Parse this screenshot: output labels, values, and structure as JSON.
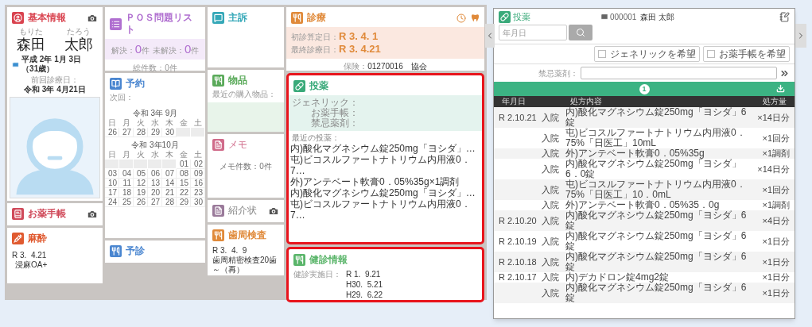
{
  "dashboard": {
    "basic_info": {
      "title": "基本情報",
      "furigana_last": "もりた",
      "furigana_first": "たろう",
      "last_name": "森田",
      "first_name": "太郎",
      "birth": "平成 2年 1月 3日（31歳）",
      "last_visit_label": "前回診療日：",
      "last_visit": "令和 3年 4月21日"
    },
    "okusuri_techo": {
      "title": "お薬手帳"
    },
    "anesthesia": {
      "title": "麻酔",
      "date": "R 3.  4.21",
      "detail": "浸麻OA+"
    },
    "pos": {
      "title": "ＰＯＳ問題リスト",
      "counts": [
        {
          "label": "解決：",
          "value": "0",
          "unit": "件"
        },
        {
          "label": "未解決：",
          "value": "0",
          "unit": "件"
        }
      ],
      "total": "総件数：0件"
    },
    "reservation": {
      "title": "予約",
      "next_label": "次回：",
      "calendars": [
        {
          "title": "令和 3年 9月",
          "weekdays": [
            "日",
            "月",
            "火",
            "水",
            "木",
            "金",
            "土"
          ],
          "days": [
            {
              "day": "26"
            },
            {
              "day": "27"
            },
            {
              "day": "28"
            },
            {
              "day": "29"
            },
            {
              "day": "30"
            },
            {
              "blank": true
            },
            {
              "blank": true
            }
          ]
        },
        {
          "title": "令和 3年10月",
          "weekdays": [
            "日",
            "月",
            "火",
            "水",
            "木",
            "金",
            "土"
          ],
          "days": [
            {
              "blank": true
            },
            {
              "blank": true
            },
            {
              "blank": true
            },
            {
              "blank": true
            },
            {
              "blank": true
            },
            {
              "day": "01"
            },
            {
              "day": "02"
            },
            {
              "day": "03"
            },
            {
              "day": "04"
            },
            {
              "day": "05"
            },
            {
              "day": "06"
            },
            {
              "day": "07"
            },
            {
              "day": "08"
            },
            {
              "day": "09"
            },
            {
              "day": "10"
            },
            {
              "day": "11"
            },
            {
              "day": "12"
            },
            {
              "day": "13"
            },
            {
              "day": "14"
            },
            {
              "day": "15"
            },
            {
              "day": "16"
            },
            {
              "day": "17"
            },
            {
              "day": "18"
            },
            {
              "day": "19"
            },
            {
              "day": "20"
            },
            {
              "day": "21"
            },
            {
              "day": "22"
            },
            {
              "day": "23"
            },
            {
              "day": "24"
            },
            {
              "day": "25"
            },
            {
              "day": "26"
            },
            {
              "day": "27"
            },
            {
              "day": "28"
            },
            {
              "day": "29"
            },
            {
              "day": "30"
            }
          ]
        }
      ]
    },
    "yoshin": {
      "title": "予診"
    },
    "chief_complaint": {
      "title": "主訴"
    },
    "goods": {
      "title": "物品",
      "recent_label": "最近の購入物品："
    },
    "memo": {
      "title": "メモ",
      "count": "メモ件数：0件"
    },
    "referral": {
      "title": "紹介状"
    },
    "perio": {
      "title": "歯周検査",
      "date": "R 3.  4.  9",
      "detail": "歯周精密検査20歯～（再）"
    },
    "treatment": {
      "title": "診療",
      "dates": [
        {
          "label": "初診算定日：",
          "value": "R 3. 4. 1"
        },
        {
          "label": "最終診療日：",
          "value": "R 3. 4.21"
        }
      ],
      "insurance_label": "保険：",
      "insurance": "01270016　協会"
    },
    "medication": {
      "title": "投薬",
      "highlighted": true,
      "fields": [
        "ジェネリック：",
        "お薬手帳：",
        "禁忌薬剤："
      ],
      "recent_label": "最近の投薬：",
      "recent": [
        "内)酸化マグネシウム錠250mg「ヨシダ」…",
        "屯)ビコスルファートナトリウム内用液0．7…",
        "外)アンテベート軟膏0．05%35g×1調剤",
        "内)酸化マグネシウム錠250mg「ヨシダ」…",
        "屯)ビコスルファートナトリウム内用液0．7…"
      ]
    },
    "checkup": {
      "title": "健診情報",
      "highlighted": true,
      "label": "健診実施日：",
      "dates": [
        "R 1.  9.21",
        "H30.  5.21",
        "H29.  6.22"
      ]
    }
  },
  "medication_panel": {
    "title": "投薬",
    "patient_id": "000001",
    "patient_name": "森田 太郎",
    "date_placeholder": "年月日",
    "checkboxes": [
      {
        "label": "ジェネリックを希望",
        "checked": false
      },
      {
        "label": "お薬手帳を希望",
        "checked": false
      }
    ],
    "contraindication_label": "禁忌薬剤：",
    "page": "1",
    "columns": {
      "date": "年月日",
      "content": "処方内容",
      "amount": "処方量"
    },
    "rows": [
      {
        "date": "R 2.10.21",
        "type": "入院",
        "content": "内)酸化マグネシウム錠250mg「ヨシダ」6錠",
        "amount": "×14日分"
      },
      {
        "type": "入院",
        "content": "屯)ビコスルファートナトリウム内用液0．75%「日医工」10mL",
        "amount": "×1回分"
      },
      {
        "type": "入院",
        "content": "外)アンテベート軟膏0．05%35g",
        "amount": "×1調剤"
      },
      {
        "type": "入院",
        "content": "内)酸化マグネシウム錠250mg「ヨシダ」6．0錠",
        "amount": "×14日分"
      },
      {
        "type": "入院",
        "content": "屯)ビコスルファートナトリウム内用液0．75%「日医工」10．0mL",
        "amount": "×1回分"
      },
      {
        "type": "入院",
        "content": "外)アンテベート軟膏0．05%35．0g",
        "amount": "×1調剤"
      },
      {
        "date": "R 2.10.20",
        "type": "入院",
        "content": "内)酸化マグネシウム錠250mg「ヨシダ」6錠",
        "amount": "×4日分"
      },
      {
        "date": "R 2.10.19",
        "type": "入院",
        "content": "内)酸化マグネシウム錠250mg「ヨシダ」6錠",
        "amount": "×1日分"
      },
      {
        "date": "R 2.10.18",
        "type": "入院",
        "content": "内)酸化マグネシウム錠250mg「ヨシダ」6錠",
        "amount": "×1日分"
      },
      {
        "date": "R 2.10.17",
        "type": "入院",
        "content": "内)デカドロン錠4mg2錠",
        "amount": "×1日分"
      },
      {
        "type": "入院",
        "content": "内)酸化マグネシウム錠250mg「ヨシダ」6錠",
        "amount": "×1日分"
      }
    ]
  }
}
